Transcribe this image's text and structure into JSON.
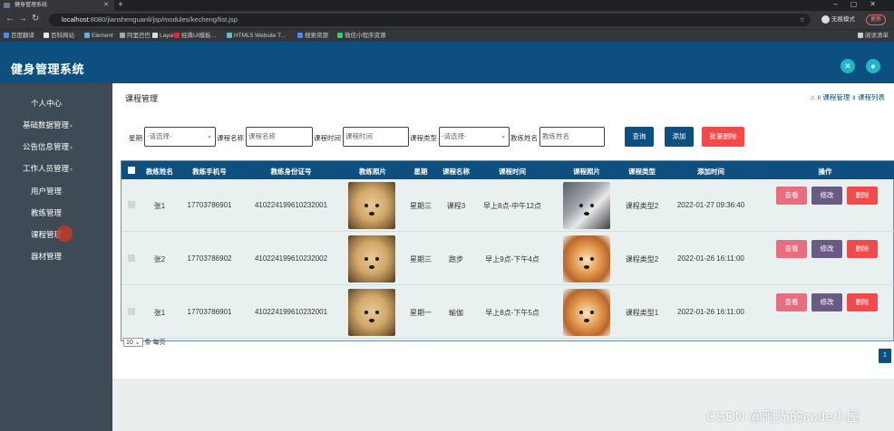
{
  "browser": {
    "tab_title": "健身管理系统",
    "url_host": "localhost",
    "url_path": ":8080/jianshenguanli/jsp/modules/kecheng/list.jsp",
    "incognito_label": "无痕模式",
    "update_label": "更新",
    "bookmarks": [
      "百度翻译",
      "百科网站",
      "Element",
      "阿里巴巴",
      "Layui",
      "经典UI模板…",
      "HTML5 Website T...",
      "搜索资源",
      "微信小程序资源"
    ],
    "reading_list": "阅读清单"
  },
  "app": {
    "title": "健身管理系统",
    "colors": {
      "header": "#0d4f7e",
      "sidebar": "#3e4a55",
      "accent": "#1fb7c8"
    }
  },
  "sidebar": {
    "items": [
      {
        "label": "个人中心",
        "has_arrow": true
      },
      {
        "label": "基础数据管理",
        "has_arrow": true
      },
      {
        "label": "公告信息管理",
        "has_arrow": true
      },
      {
        "label": "工作人员管理",
        "has_arrow": true
      },
      {
        "label": "用户管理",
        "has_arrow": true
      },
      {
        "label": "教练管理",
        "has_arrow": true
      },
      {
        "label": "课程管理",
        "has_arrow": true
      },
      {
        "label": "器材管理",
        "has_arrow": true
      }
    ]
  },
  "page": {
    "title": "课程管理",
    "breadcrumb": [
      "课程管理",
      "课程列表"
    ]
  },
  "search": {
    "week_label": "星期",
    "week_value": "-请选择-",
    "course_name_label": "课程名称",
    "course_name_placeholder": "课程名称",
    "course_time_label": "课程时间",
    "course_time_placeholder": "课程时间",
    "course_type_label": "课程类型",
    "course_type_value": "-请选择-",
    "coach_name_label": "教练姓名",
    "coach_name_placeholder": "教练姓名",
    "query_label": "查询",
    "add_label": "添加",
    "batch_delete_label": "批量删除"
  },
  "table": {
    "columns": [
      "教练姓名",
      "教练手机号",
      "教练身份证号",
      "教练照片",
      "星期",
      "课程名称",
      "课程时间",
      "课程照片",
      "课程类型",
      "添加时间",
      "操作"
    ],
    "rows": [
      {
        "coach_name": "张1",
        "phone": "17703786901",
        "id_card": "410224199610232001",
        "coach_photo": "puppy",
        "week": "星期三",
        "course_name": "课程3",
        "course_time": "早上8点-中午12点",
        "course_photo": "husky",
        "course_type": "课程类型2",
        "added": "2022-01-27 09:36:40"
      },
      {
        "coach_name": "张2",
        "phone": "17703786902",
        "id_card": "410224199610232002",
        "coach_photo": "puppy",
        "week": "星期三",
        "course_name": "跑步",
        "course_time": "早上9点-下午4点",
        "course_photo": "shiba",
        "course_type": "课程类型2",
        "added": "2022-01-26 16:11:00"
      },
      {
        "coach_name": "张1",
        "phone": "17703786901",
        "id_card": "410224199610232001",
        "coach_photo": "puppy",
        "week": "星期一",
        "course_name": "瑜伽",
        "course_time": "早上8点-下午5点",
        "course_photo": "shiba",
        "course_type": "课程类型1",
        "added": "2022-01-26 16:11:00"
      }
    ],
    "actions": {
      "view": "查看",
      "edit": "修改",
      "delete": "删除"
    }
  },
  "pagination": {
    "page_size": "10",
    "per_page_text": "条 每页",
    "current_page": "1"
  },
  "watermark": "CSDN @阿光的code小屋"
}
